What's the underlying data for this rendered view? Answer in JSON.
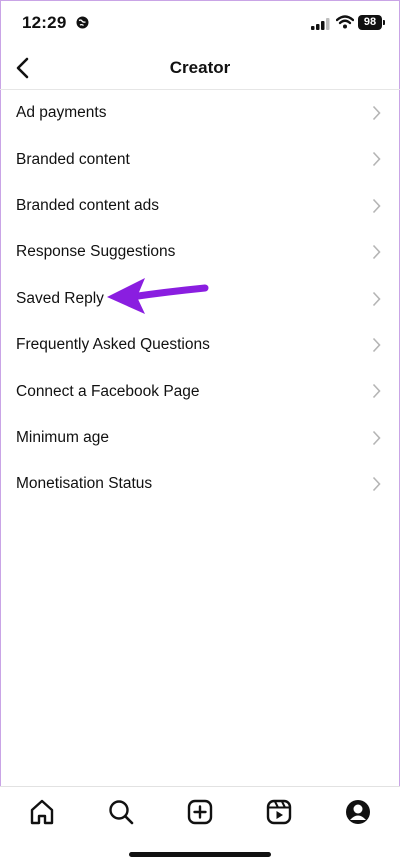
{
  "status_bar": {
    "time": "12:29",
    "battery": "98",
    "icons": [
      "globe-icon",
      "signal-icon",
      "wifi-icon",
      "battery-icon"
    ]
  },
  "header": {
    "title": "Creator",
    "back_icon": "chevron-left-icon"
  },
  "menu": {
    "items": [
      {
        "label": "Ad payments"
      },
      {
        "label": "Branded content"
      },
      {
        "label": "Branded content ads"
      },
      {
        "label": "Response Suggestions"
      },
      {
        "label": "Saved Reply"
      },
      {
        "label": "Frequently Asked Questions"
      },
      {
        "label": "Connect a Facebook Page"
      },
      {
        "label": "Minimum age"
      },
      {
        "label": "Monetisation Status"
      }
    ]
  },
  "annotation": {
    "arrow_color": "#8a1ee0",
    "points_to": "Saved Reply"
  },
  "tab_bar": {
    "tabs": [
      "home-icon",
      "search-icon",
      "create-icon",
      "reels-icon",
      "profile-icon"
    ]
  }
}
